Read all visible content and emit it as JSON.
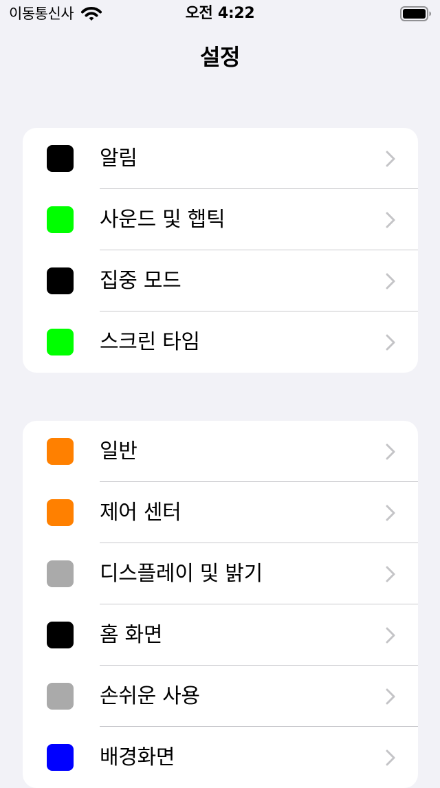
{
  "status_bar": {
    "carrier": "이동통신사",
    "time": "오전 4:22"
  },
  "nav": {
    "title": "설정"
  },
  "groups": [
    {
      "items": [
        {
          "label": "알림",
          "icon": "notifications-icon",
          "color": "#000000"
        },
        {
          "label": "사운드 및 햅틱",
          "icon": "sounds-haptics-icon",
          "color": "#00ff00"
        },
        {
          "label": "집중 모드",
          "icon": "focus-icon",
          "color": "#000000"
        },
        {
          "label": "스크린 타임",
          "icon": "screen-time-icon",
          "color": "#00ff00"
        }
      ]
    },
    {
      "items": [
        {
          "label": "일반",
          "icon": "general-icon",
          "color": "#ff8000"
        },
        {
          "label": "제어 센터",
          "icon": "control-center-icon",
          "color": "#ff8000"
        },
        {
          "label": "디스플레이 및 밝기",
          "icon": "display-brightness-icon",
          "color": "#aaaaaa"
        },
        {
          "label": "홈 화면",
          "icon": "home-screen-icon",
          "color": "#000000"
        },
        {
          "label": "손쉬운 사용",
          "icon": "accessibility-icon",
          "color": "#aaaaaa"
        },
        {
          "label": "배경화면",
          "icon": "wallpaper-icon",
          "color": "#0000ff"
        }
      ]
    }
  ]
}
